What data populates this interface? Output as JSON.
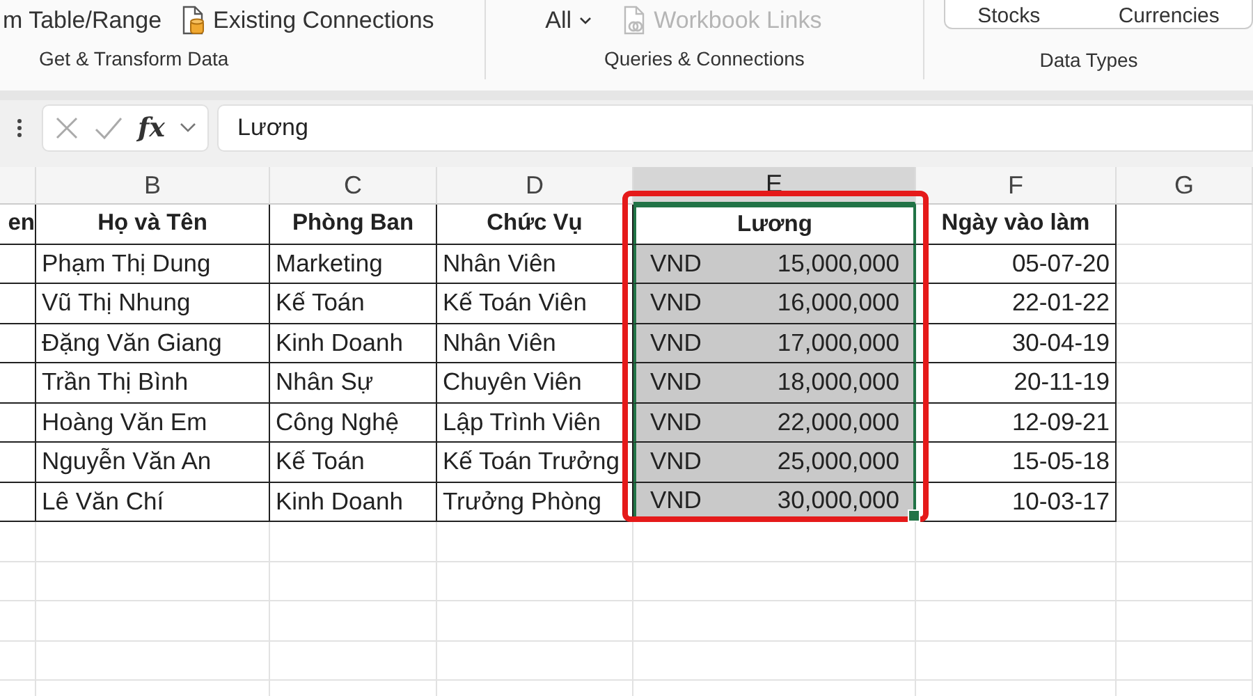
{
  "ribbon": {
    "groups": [
      {
        "label": "Get & Transform Data",
        "items": [
          {
            "kind": "text",
            "label": "m Table/Range",
            "disabled": false
          },
          {
            "kind": "connections",
            "label": "Existing Connections",
            "disabled": false
          }
        ]
      },
      {
        "label": "Queries & Connections",
        "items": [
          {
            "kind": "dropdown",
            "label": "All",
            "disabled": false
          },
          {
            "kind": "links",
            "label": "Workbook Links",
            "disabled": true
          }
        ]
      },
      {
        "label": "Data Types",
        "items": [
          {
            "kind": "datatype",
            "label": "Stocks",
            "disabled": false
          },
          {
            "kind": "datatype",
            "label": "Currencies",
            "disabled": false
          }
        ]
      }
    ]
  },
  "formula_bar": {
    "function_label": "fx",
    "value": "Lương"
  },
  "sheet": {
    "columns": [
      {
        "letter": "B",
        "selected": false
      },
      {
        "letter": "C",
        "selected": false
      },
      {
        "letter": "D",
        "selected": false
      },
      {
        "letter": "E",
        "selected": true
      },
      {
        "letter": "F",
        "selected": false
      },
      {
        "letter": "G",
        "selected": false
      }
    ],
    "header_row": [
      "en",
      "Họ và Tên",
      "Phòng Ban",
      "Chức Vụ",
      "Lương",
      "Ngày vào làm"
    ],
    "rows": [
      {
        "name": "Phạm Thị Dung",
        "department": "Marketing",
        "position": "Nhân Viên",
        "salary_cell": {
          "currency": "VND",
          "amount": "15,000,000",
          "selected": true
        },
        "start_date": "05-07-20"
      },
      {
        "name": "Vũ Thị Nhung",
        "department": "Kế Toán",
        "position": "Kế Toán Viên",
        "salary_cell": {
          "currency": "VND",
          "amount": "16,000,000",
          "selected": true
        },
        "start_date": "22-01-22"
      },
      {
        "name": "Đặng Văn Giang",
        "department": "Kinh Doanh",
        "position": "Nhân Viên",
        "salary_cell": {
          "currency": "VND",
          "amount": "17,000,000",
          "selected": true
        },
        "start_date": "30-04-19"
      },
      {
        "name": "Trần Thị Bình",
        "department": "Nhân Sự",
        "position": "Chuyên Viên",
        "salary_cell": {
          "currency": "VND",
          "amount": "18,000,000",
          "selected": true
        },
        "start_date": "20-11-19"
      },
      {
        "name": "Hoàng Văn Em",
        "department": "Công Nghệ",
        "position": "Lập Trình Viên",
        "salary_cell": {
          "currency": "VND",
          "amount": "22,000,000",
          "selected": true
        },
        "start_date": "12-09-21"
      },
      {
        "name": "Nguyễn Văn An",
        "department": "Kế Toán",
        "position": "Kế Toán Trưởng",
        "salary_cell": {
          "currency": "VND",
          "amount": "25,000,000",
          "selected": true
        },
        "start_date": "15-05-18"
      },
      {
        "name": "Lê Văn Chí",
        "department": "Kinh Doanh",
        "position": "Trưởng Phòng",
        "salary_cell": {
          "currency": "VND",
          "amount": "30,000,000",
          "selected": true
        },
        "start_date": "10-03-17"
      }
    ],
    "highlight_frame": true
  }
}
